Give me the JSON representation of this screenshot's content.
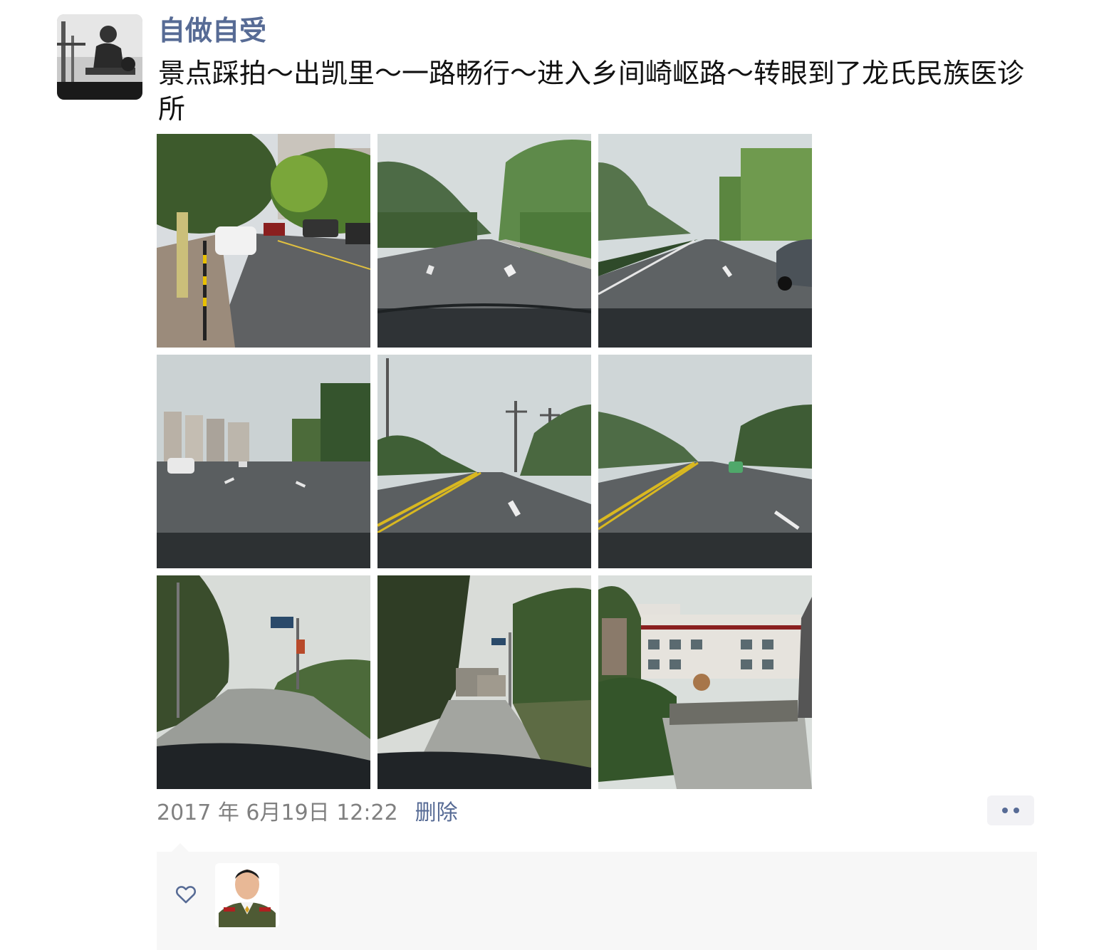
{
  "post": {
    "author": "自做自受",
    "text": "景点踩拍～出凯里～一路畅行～进入乡间崎岖路～转眼到了龙氏民族医诊所",
    "timestamp": "2017 年 6月19日 12:22",
    "delete_label": "删除",
    "photos": [
      {
        "name": "photo-city-street"
      },
      {
        "name": "photo-highway-mountains"
      },
      {
        "name": "photo-highway-car"
      },
      {
        "name": "photo-town-road"
      },
      {
        "name": "photo-road-power-lines"
      },
      {
        "name": "photo-road-green-car"
      },
      {
        "name": "photo-country-road-sign"
      },
      {
        "name": "photo-country-road-village"
      },
      {
        "name": "photo-clinic-building"
      }
    ]
  },
  "likes": {
    "icon": "heart-icon",
    "avatars": [
      {
        "name": "liker-avatar-1"
      }
    ]
  },
  "colors": {
    "link": "#576b95",
    "timestamp": "#808080",
    "likes_bg": "#f7f7f7"
  }
}
